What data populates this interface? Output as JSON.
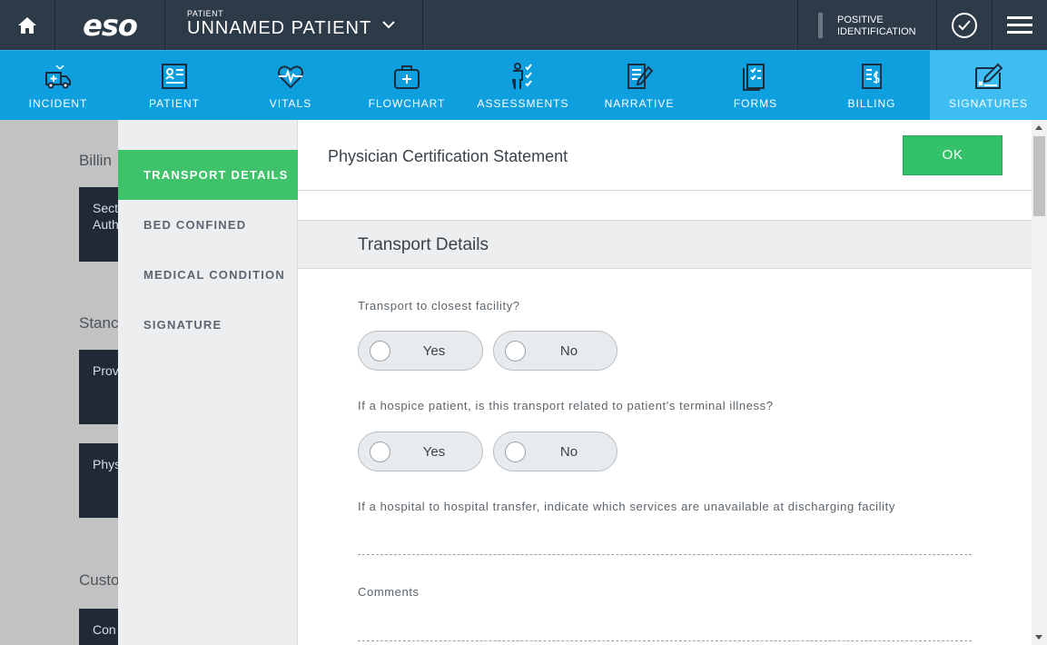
{
  "topbar": {
    "logo": "eso",
    "patient_small": "PATIENT",
    "patient_name": "UNNAMED PATIENT",
    "positive_id_line1": "POSITIVE",
    "positive_id_line2": "IDENTIFICATION"
  },
  "nav": {
    "tabs": [
      {
        "label": "INCIDENT",
        "icon": "ambulance-icon"
      },
      {
        "label": "PATIENT",
        "icon": "patient-card-icon"
      },
      {
        "label": "VITALS",
        "icon": "heart-pulse-icon"
      },
      {
        "label": "FLOWCHART",
        "icon": "medical-bag-icon"
      },
      {
        "label": "ASSESSMENTS",
        "icon": "assessment-icon"
      },
      {
        "label": "NARRATIVE",
        "icon": "narrative-icon"
      },
      {
        "label": "FORMS",
        "icon": "forms-icon"
      },
      {
        "label": "BILLING",
        "icon": "billing-icon"
      },
      {
        "label": "SIGNATURES",
        "icon": "signature-icon"
      }
    ],
    "active": "SIGNATURES"
  },
  "background": {
    "headings": [
      "Billin",
      "Stanc",
      "Custo"
    ],
    "cards": [
      "Sect\nAuth",
      "Prov",
      "Phys",
      "Con"
    ]
  },
  "sidebar": {
    "items": [
      {
        "label": "TRANSPORT DETAILS",
        "active": true
      },
      {
        "label": "BED CONFINED",
        "active": false
      },
      {
        "label": "MEDICAL CONDITION",
        "active": false
      },
      {
        "label": "SIGNATURE",
        "active": false
      }
    ]
  },
  "modal": {
    "title": "Physician Certification Statement",
    "ok_label": "OK",
    "section_title": "Transport Details",
    "questions": [
      {
        "label": "Transport to closest facility?",
        "yes": "Yes",
        "no": "No"
      },
      {
        "label": "If a hospice patient, is this transport related to patient's terminal illness?",
        "yes": "Yes",
        "no": "No"
      }
    ],
    "hospital_transfer_label": "If a hospital to hospital transfer, indicate which services are unavailable at discharging facility",
    "comments_label": "Comments"
  },
  "colors": {
    "topbar": "#2d3a48",
    "nav": "#0e9fdf",
    "nav_active": "#3dbdf1",
    "green": "#3ec26a"
  }
}
